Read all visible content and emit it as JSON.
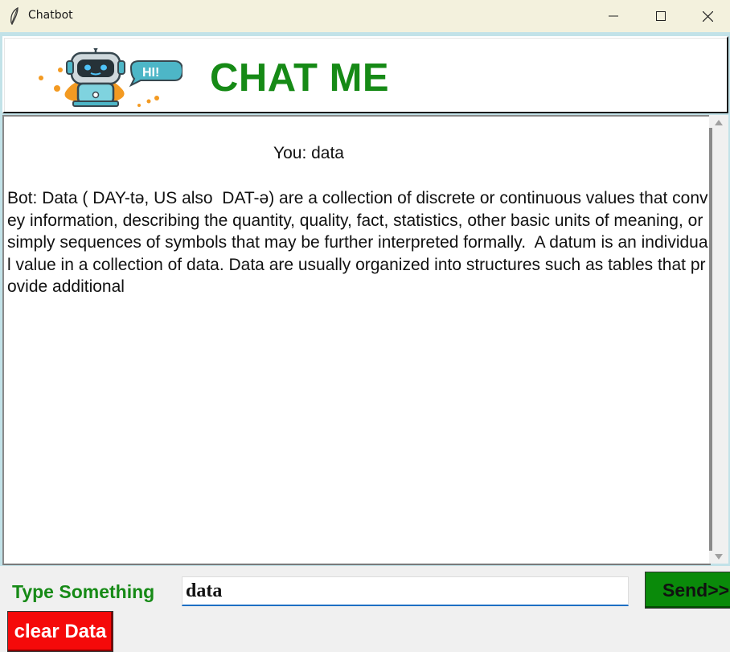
{
  "window": {
    "title": "Chatbot",
    "icon": "feather-icon",
    "controls": [
      "minimize-icon",
      "maximize-icon",
      "close-icon"
    ]
  },
  "header": {
    "logo_text": "HI!",
    "title": "CHAT ME",
    "title_color": "#168a16"
  },
  "chat": {
    "messages": [
      {
        "sender": "user",
        "text": "You: data"
      },
      {
        "sender": "bot",
        "text": "Bot: Data ( DAY-tə, US also  DAT-ə) are a collection of discrete or continuous values that convey information, describing the quantity, quality, fact, statistics, other basic units of meaning, or simply sequences of symbols that may be further interpreted formally.  A datum is an individual value in a collection of data. Data are usually organized into structures such as tables that provide additional"
      }
    ]
  },
  "input": {
    "label": "Type Something",
    "value": "data"
  },
  "buttons": {
    "send": "Send>>",
    "send_color": "#0a8a0a",
    "clear": "clear Data",
    "clear_color": "#f50a0a"
  }
}
